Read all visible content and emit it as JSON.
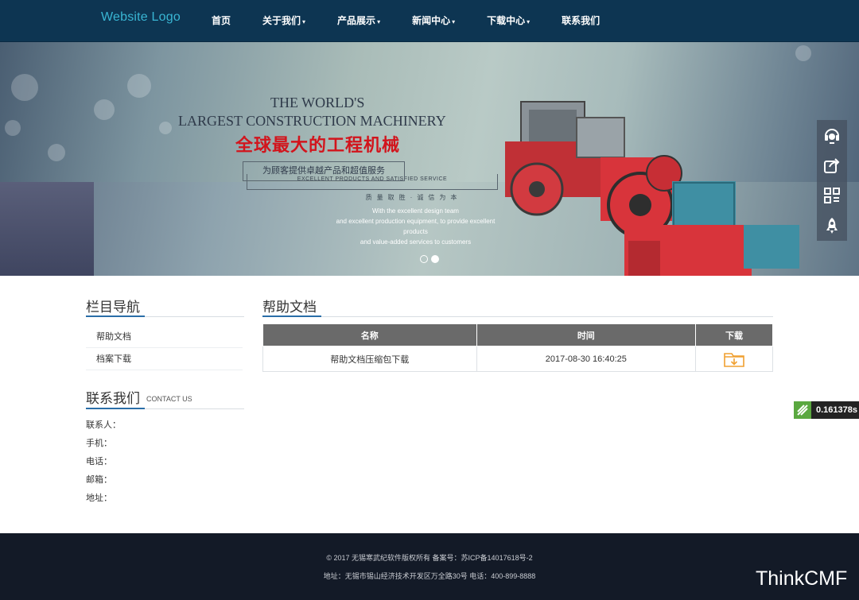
{
  "header": {
    "logo": "Website Logo",
    "nav": [
      {
        "label": "首页",
        "caret": ""
      },
      {
        "label": "关于我们",
        "caret": "▾"
      },
      {
        "label": "产品展示",
        "caret": "▾"
      },
      {
        "label": "新闻中心",
        "caret": "▾"
      },
      {
        "label": "下载中心",
        "caret": "▾"
      },
      {
        "label": "联系我们",
        "caret": ""
      }
    ]
  },
  "banner": {
    "title_line1": "THE WORLD'S",
    "title_line2": "LARGEST CONSTRUCTION MACHINERY",
    "title_cn": "全球最大的工程机械",
    "box_text": "为顾客提供卓越产品和超值服务",
    "box_sub": "EXCELLENT PRODUCTS AND SATISFIED SERVICE",
    "motto": "质量取胜·诚信为本",
    "sub_lines": [
      "With the excellent design team",
      "and excellent production equipment, to provide excellent",
      "products",
      "and value-added services to customers"
    ],
    "slides_total": 2,
    "active_slide": 2
  },
  "tools": [
    "headset-icon",
    "share-icon",
    "qrcode-icon",
    "rocket-icon"
  ],
  "sidebar": {
    "title": "栏目导航",
    "items": [
      "帮助文档",
      "档案下载"
    ],
    "contact_title": "联系我们",
    "contact_en": "CONTACT US",
    "contact_rows": [
      "联系人：",
      "手机：",
      "电话：",
      "邮箱：",
      "地址："
    ]
  },
  "main": {
    "title": "帮助文档",
    "columns": [
      "名称",
      "时间",
      "下载"
    ],
    "rows": [
      {
        "name": "帮助文档压缩包下载",
        "time": "2017-08-30 16:40:25",
        "download_icon": "folder-download-icon"
      }
    ]
  },
  "speed_badge": "0.161378s",
  "footer": {
    "line1": "© 2017 无锡寒武纪软件版权所有 备案号：苏ICP备14017618号-2",
    "line2": "地址：无锡市锡山经济技术开发区万全路30号 电话：400-899-8888"
  },
  "watermark": "ThinkCMF",
  "colors": {
    "header_bg": "#0d3552",
    "logo": "#39b6d4",
    "accent_line": "#2a6ea8",
    "table_head": "#6a6a6a",
    "download_icon": "#f0a030",
    "footer_bg": "#131a27"
  }
}
